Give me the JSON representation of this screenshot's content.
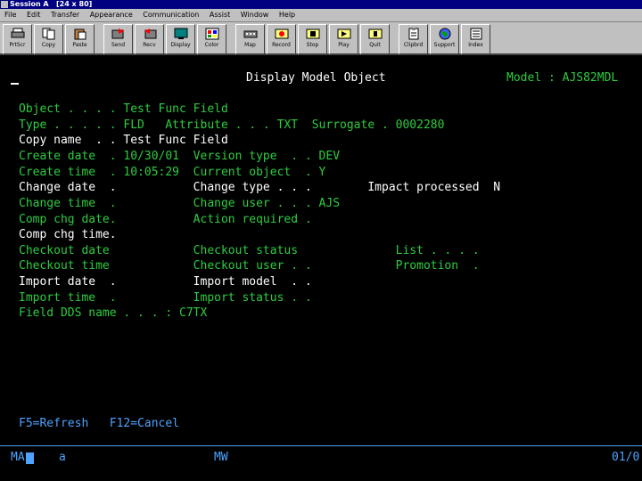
{
  "window": {
    "title": "Session A",
    "size": "[24 x 80]"
  },
  "menu": [
    "File",
    "Edit",
    "Transfer",
    "Appearance",
    "Communication",
    "Assist",
    "Window",
    "Help"
  ],
  "toolbar": [
    {
      "label": "PrtScr",
      "icon": "printer-icon"
    },
    {
      "label": "Copy",
      "icon": "copy-icon"
    },
    {
      "label": "Paste",
      "icon": "paste-icon"
    },
    {
      "label": "Send",
      "icon": "send-icon"
    },
    {
      "label": "Recv",
      "icon": "receive-icon"
    },
    {
      "label": "Display",
      "icon": "display-icon"
    },
    {
      "label": "Color",
      "icon": "color-palette-icon"
    },
    {
      "label": "Map",
      "icon": "keyboard-map-icon"
    },
    {
      "label": "Record",
      "icon": "record-macro-icon"
    },
    {
      "label": "Stop",
      "icon": "stop-macro-icon"
    },
    {
      "label": "Play",
      "icon": "play-macro-icon"
    },
    {
      "label": "Quit",
      "icon": "quit-icon"
    },
    {
      "label": "Clipbrd",
      "icon": "clipboard-icon"
    },
    {
      "label": "Support",
      "icon": "globe-icon"
    },
    {
      "label": "Index",
      "icon": "index-book-icon"
    }
  ],
  "screen": {
    "title": "Display Model Object",
    "model": "Model : AJS82MDL",
    "lines": [
      "Object . . . . Test Func Field",
      "Type . . . . . FLD   Attribute . . . TXT  Surrogate . 0002280",
      "Copy name  . . Test Func Field",
      "Create date  . 10/30/01  Version type  . . DEV",
      "Create time  . 10:05:29  Current object  . Y",
      "Change date  .           Change type . . .        Impact processed  N",
      "Change time  .           Change user . . . AJS",
      "Comp chg date.           Action required .",
      "Comp chg time.",
      "Checkout date            Checkout status              List . . . .",
      "Checkout time            Checkout user . .            Promotion  .",
      "Import date  .           Import model  . .",
      "Import time  .           Import status . .",
      "Field DDS name . . . : C7TX"
    ],
    "fkeys": "F5=Refresh   F12=Cancel"
  },
  "status": {
    "left": "MA",
    "sub": "a",
    "mid": "MW",
    "right": "01/0"
  },
  "colors": {
    "field_label": "#2ecc40",
    "value": "#ffffff",
    "fkeys": "#4da3ff"
  }
}
